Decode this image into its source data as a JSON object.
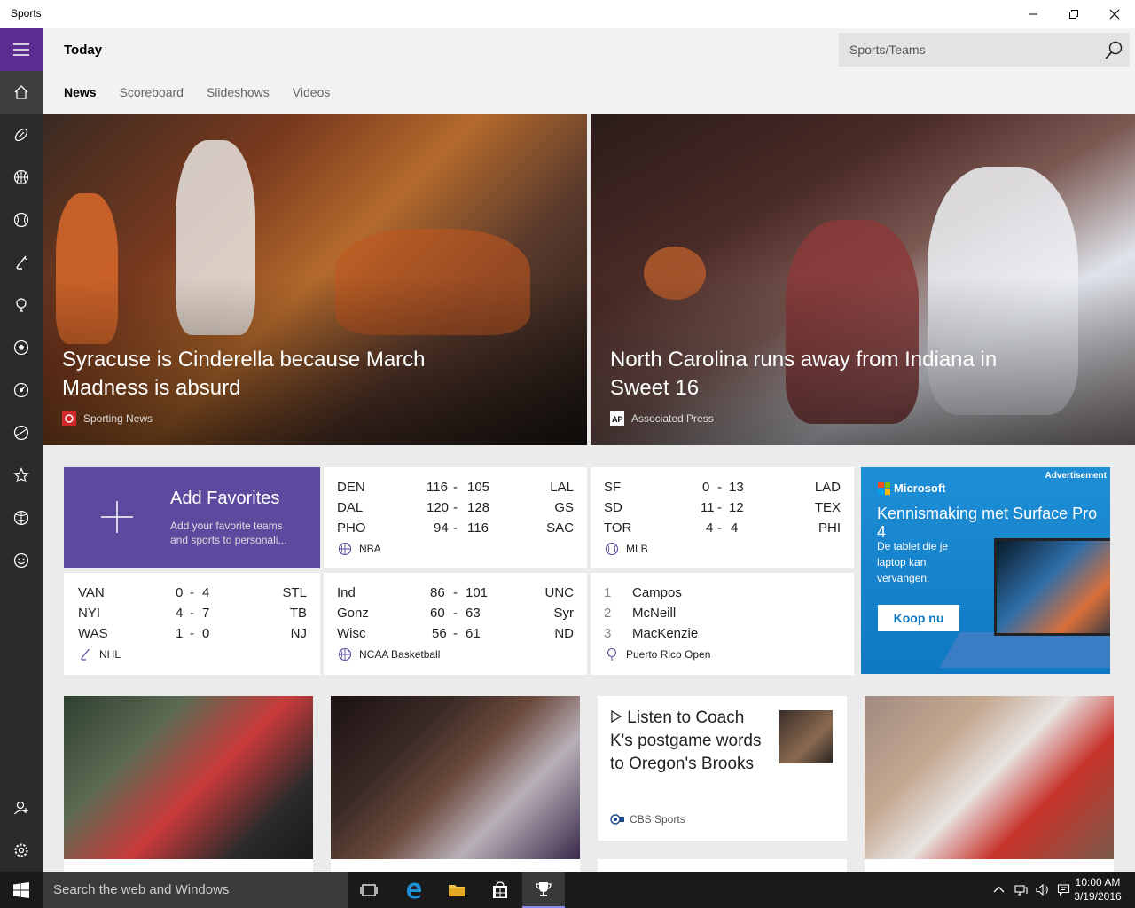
{
  "window": {
    "title": "Sports"
  },
  "header": {
    "page_title": "Today",
    "search_placeholder": "Sports/Teams",
    "tabs": [
      {
        "label": "News",
        "active": true
      },
      {
        "label": "Scoreboard",
        "active": false
      },
      {
        "label": "Slideshows",
        "active": false
      },
      {
        "label": "Videos",
        "active": false
      }
    ]
  },
  "nav_icons": [
    "menu-icon",
    "home-icon",
    "football-icon",
    "basketball-icon",
    "baseball-icon",
    "hockey-icon",
    "golf-icon",
    "soccer-icon",
    "racing-icon",
    "tennis-icon",
    "favorites-icon",
    "college-basketball-icon",
    "fantasy-icon",
    "account-icon",
    "settings-icon"
  ],
  "hero": [
    {
      "title": "Syracuse is Cinderella because March Madness is absurd",
      "source": "Sporting News"
    },
    {
      "title": "North Carolina runs away from Indiana in Sweet 16",
      "source": "Associated Press"
    }
  ],
  "favorites": {
    "title": "Add Favorites",
    "description": "Add your favorite teams and sports to personali..."
  },
  "scores": {
    "nba": {
      "league": "NBA",
      "games": [
        {
          "home": "DEN",
          "home_score": "116",
          "away_score": "105",
          "away": "LAL"
        },
        {
          "home": "DAL",
          "home_score": "120",
          "away_score": "128",
          "away": "GS"
        },
        {
          "home": "PHO",
          "home_score": "94",
          "away_score": "116",
          "away": "SAC"
        }
      ]
    },
    "mlb": {
      "league": "MLB",
      "games": [
        {
          "home": "SF",
          "home_score": "0",
          "away_score": "13",
          "away": "LAD"
        },
        {
          "home": "SD",
          "home_score": "11",
          "away_score": "12",
          "away": "TEX"
        },
        {
          "home": "TOR",
          "home_score": "4",
          "away_score": "4",
          "away": "PHI"
        }
      ]
    },
    "nhl": {
      "league": "NHL",
      "games": [
        {
          "home": "VAN",
          "home_score": "0",
          "away_score": "4",
          "away": "STL"
        },
        {
          "home": "NYI",
          "home_score": "4",
          "away_score": "7",
          "away": "TB"
        },
        {
          "home": "WAS",
          "home_score": "1",
          "away_score": "0",
          "away": "NJ"
        }
      ]
    },
    "ncaa": {
      "league": "NCAA Basketball",
      "games": [
        {
          "home": "Ind",
          "home_score": "86",
          "away_score": "101",
          "away": "UNC"
        },
        {
          "home": "Gonz",
          "home_score": "60",
          "away_score": "63",
          "away": "Syr"
        },
        {
          "home": "Wisc",
          "home_score": "56",
          "away_score": "61",
          "away": "ND"
        }
      ]
    },
    "golf": {
      "league": "Puerto Rico Open",
      "leaders": [
        {
          "rank": "1",
          "name": "Campos"
        },
        {
          "rank": "2",
          "name": "McNeill"
        },
        {
          "rank": "3",
          "name": "MacKenzie"
        }
      ]
    }
  },
  "ad": {
    "label": "Advertisement",
    "brand": "Microsoft",
    "headline": "Kennismaking met Surface Pro 4",
    "body": "De tablet die je laptop kan vervangen.",
    "cta": "Koop nu"
  },
  "video_card": {
    "title": "Listen to Coach K's postgame words to Oregon's Brooks",
    "source": "CBS Sports"
  },
  "taskbar": {
    "search_placeholder": "Search the web and Windows",
    "time": "10:00 AM",
    "date": "3/19/2016"
  },
  "colors": {
    "accent": "#5c2d91",
    "favorites_tile": "#5c4a9e",
    "ad_blue": "#0e78c2"
  }
}
